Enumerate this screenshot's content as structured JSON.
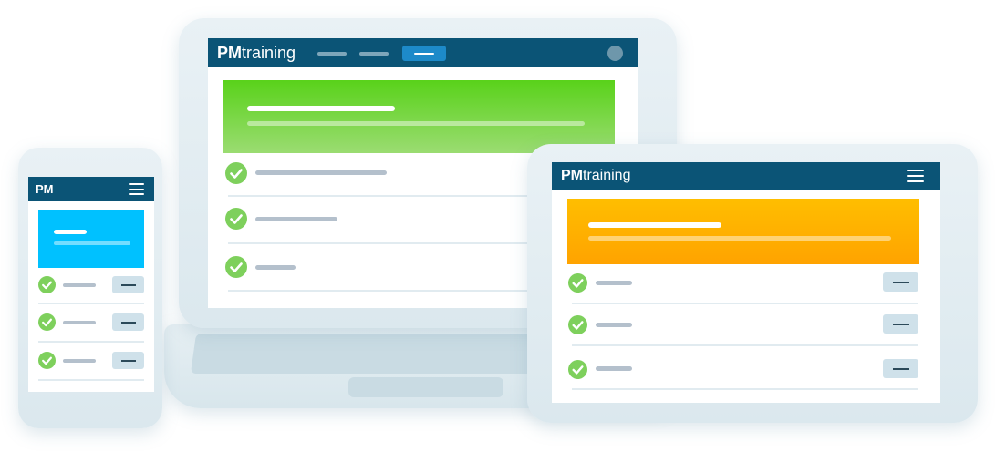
{
  "brand": {
    "logo_bold": "PM",
    "logo_rest": "training"
  },
  "colors": {
    "appbar": "#0b5476",
    "desktop_hero": "#6fd437",
    "phone_hero": "#00c1ff",
    "tablet_hero": "#ffac00",
    "check": "#7ed05c",
    "frame": "#e4eef2"
  },
  "icons": {
    "check": "checkmark-circle-icon",
    "menu": "hamburger-menu-icon",
    "avatar": "user-avatar-icon"
  },
  "desktop": {
    "row_count": 3
  },
  "phone": {
    "row_count": 3
  },
  "tablet": {
    "row_count": 3
  }
}
